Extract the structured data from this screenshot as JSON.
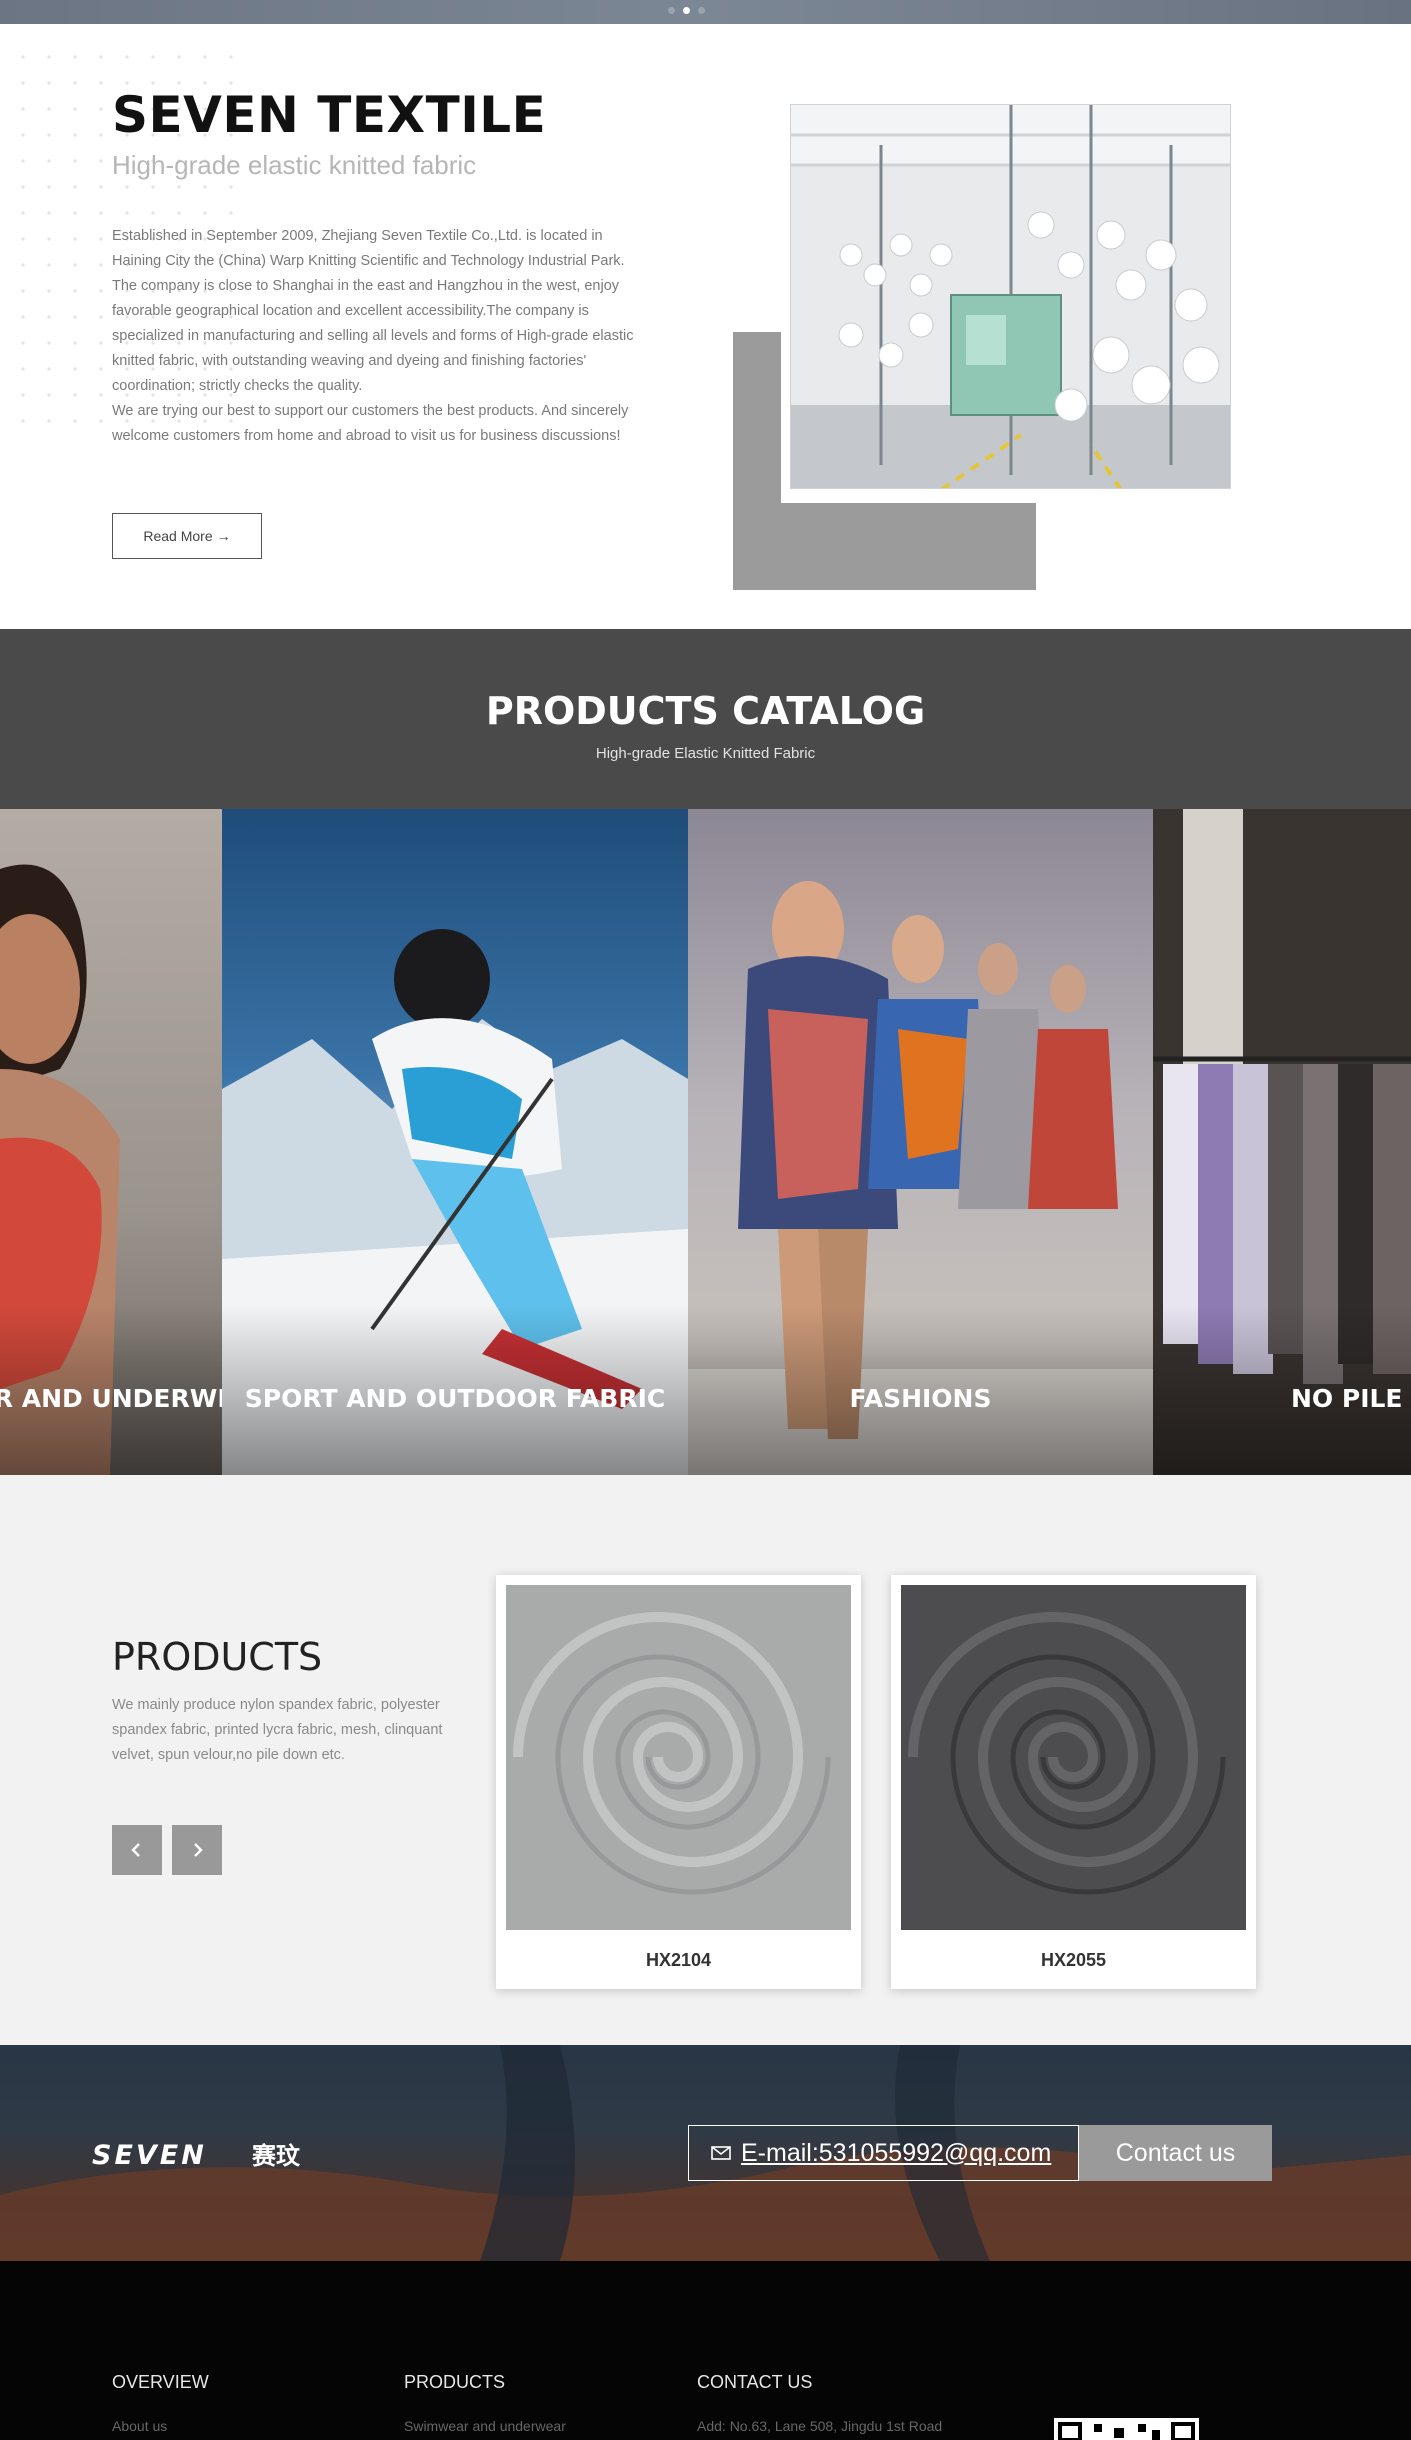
{
  "carousel": {
    "dot_count": 3,
    "active_index": 1
  },
  "about": {
    "title": "SEVEN TEXTILE",
    "subtitle": "High-grade elastic knitted fabric",
    "paragraph_1": "Established in September 2009, Zhejiang Seven Textile Co.,Ltd. is located in Haining City the (China) Warp Knitting Scientific and Technology Industrial Park. The company is close to Shanghai in the east and Hangzhou in the west, enjoy favorable geographical location and excellent accessibility.The company is specialized in manufacturing and selling all levels and forms of High-grade elastic knitted fabric, with outstanding weaving and dyeing and finishing factories' coordination; strictly checks the quality.",
    "paragraph_2": "We are trying our best to support our customers the best products. And sincerely welcome customers from home and abroad to visit us for business discussions!",
    "read_more_label": "Read More",
    "read_more_arrow": "→"
  },
  "catalog": {
    "title": "PRODUCTS CATALOG",
    "subtitle": "High-grade Elastic Knitted Fabric",
    "slides": [
      {
        "label": "SWIMWEAR AND UNDERWEAR"
      },
      {
        "label": "SPORT AND OUTDOOR FABRIC"
      },
      {
        "label": "FASHIONS"
      },
      {
        "label": "NO PILE DOWN"
      }
    ]
  },
  "products": {
    "title": "PRODUCTS",
    "description": "We mainly produce nylon spandex fabric, polyester spandex fabric, printed lycra fabric, mesh, clinquant velvet, spun velour,no pile down etc.",
    "prev_icon": "‹",
    "next_icon": "›",
    "items": [
      {
        "code": "HX2104",
        "color": "#a9abab"
      },
      {
        "code": "HX2055",
        "color": "#4d4d4f"
      }
    ]
  },
  "contact": {
    "logo_text": "SEVEN",
    "logo_cn": "赛玟",
    "email_label": "E-mail:531055992@qq.com",
    "button_label": "Contact us"
  },
  "footer": {
    "columns": [
      {
        "title": "OVERVIEW",
        "first_item": "About us"
      },
      {
        "title": "PRODUCTS",
        "first_item": "Swimwear and underwear"
      },
      {
        "title": "CONTACT US",
        "first_item": "Add: No.63, Lane 508, Jingdu 1st Road"
      }
    ]
  }
}
